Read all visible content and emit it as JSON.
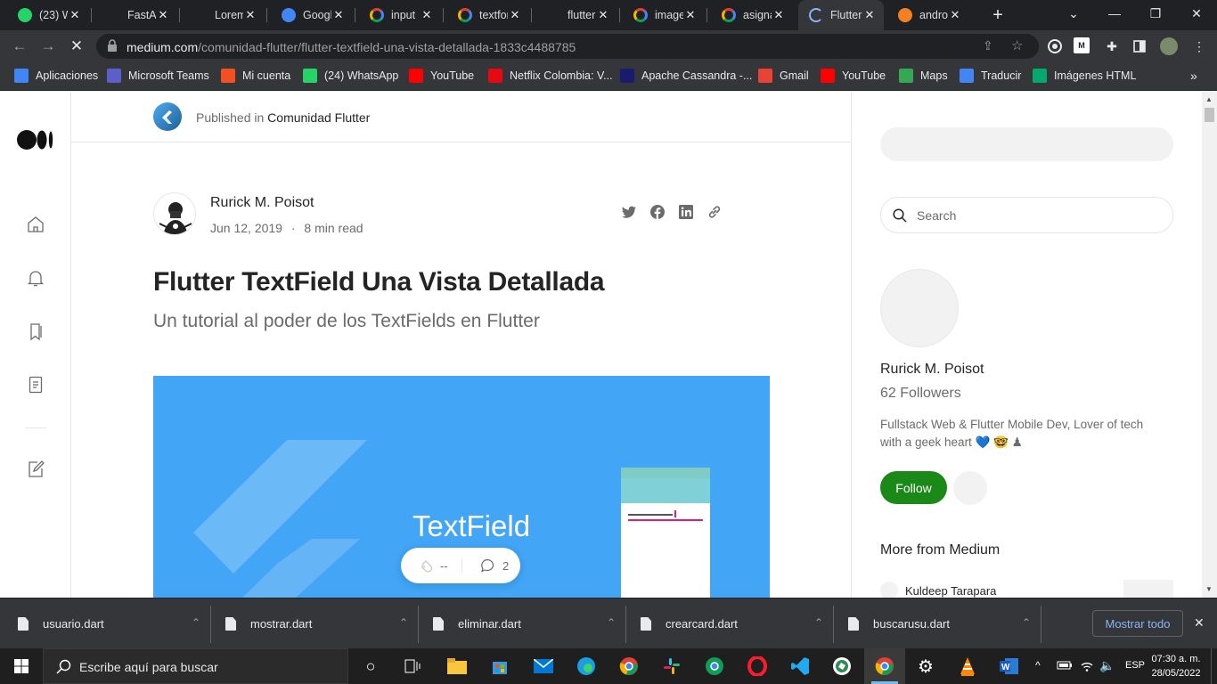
{
  "browser": {
    "tabs": [
      {
        "label": "(23) W",
        "favicon": "whatsapp-icon",
        "color": "#25d366"
      },
      {
        "label": "FastAP",
        "favicon": "fastapi-icon",
        "color": "#202124"
      },
      {
        "label": "Lorem",
        "favicon": "github-icon",
        "color": "#202124"
      },
      {
        "label": "Googl",
        "favicon": "google-translate-icon",
        "color": "#4285f4"
      },
      {
        "label": "input",
        "favicon": "google-icon",
        "color": "#ffffff"
      },
      {
        "label": "textfor",
        "favicon": "google-icon",
        "color": "#ffffff"
      },
      {
        "label": "flutter",
        "favicon": "flutter-icon",
        "color": "#202124"
      },
      {
        "label": "image",
        "favicon": "google-icon",
        "color": "#ffffff"
      },
      {
        "label": "asigna",
        "favicon": "google-icon",
        "color": "#ffffff"
      },
      {
        "label": "Flutter",
        "favicon": "loading-icon",
        "color": "#8ab4f8"
      },
      {
        "label": "androi",
        "favicon": "stackoverflow-icon",
        "color": "#f48024"
      }
    ],
    "active_tab_index": 9,
    "url_domain": "medium.com",
    "url_path": "/comunidad-flutter/flutter-textfield-una-vista-detallada-1833c4488785",
    "bookmarks": [
      {
        "label": "Aplicaciones",
        "icon": "apps-grid-icon"
      },
      {
        "label": "Microsoft Teams",
        "icon": "teams-icon"
      },
      {
        "label": "Mi cuenta",
        "icon": "microsoft-icon"
      },
      {
        "label": "(24) WhatsApp",
        "icon": "whatsapp-icon"
      },
      {
        "label": "YouTube",
        "icon": "youtube-icon"
      },
      {
        "label": "Netflix Colombia: V...",
        "icon": "netflix-icon"
      },
      {
        "label": "Apache Cassandra -...",
        "icon": "cassandra-icon"
      },
      {
        "label": "Gmail",
        "icon": "gmail-icon"
      },
      {
        "label": "YouTube",
        "icon": "youtube-icon"
      },
      {
        "label": "Maps",
        "icon": "maps-icon"
      },
      {
        "label": "Traducir",
        "icon": "google-translate-icon"
      },
      {
        "label": "Imágenes HTML",
        "icon": "w3schools-icon"
      }
    ]
  },
  "article": {
    "published_prefix": "Published in",
    "publication": "Comunidad Flutter",
    "author": "Rurick M. Poisot",
    "date": "Jun 12, 2019",
    "separator": "·",
    "read_time": "8 min read",
    "title": "Flutter TextField Una Vista Detallada",
    "subtitle": "Un tutorial al poder de los TextFields en Flutter",
    "hero_text": "TextField",
    "hero_bg": "#42a5f5",
    "claps": "--",
    "responses": "2"
  },
  "sidebar": {
    "search_placeholder": "Search",
    "author_name": "Rurick M. Poisot",
    "followers": "62 Followers",
    "bio": "Fullstack Web & Flutter Mobile Dev, Lover of tech with a geek heart 💙 🤓 ♟",
    "follow_label": "Follow",
    "more_heading": "More from Medium",
    "more_item_author": "Kuldeep Tarapara",
    "accent": "#1a8917"
  },
  "downloads": {
    "items": [
      "usuario.dart",
      "mostrar.dart",
      "eliminar.dart",
      "crearcard.dart",
      "buscarusu.dart"
    ],
    "show_all": "Mostrar todo"
  },
  "taskbar": {
    "search_placeholder": "Escribe aquí para buscar",
    "language": "ESP",
    "time": "07:30 a. m.",
    "date": "28/05/2022"
  }
}
